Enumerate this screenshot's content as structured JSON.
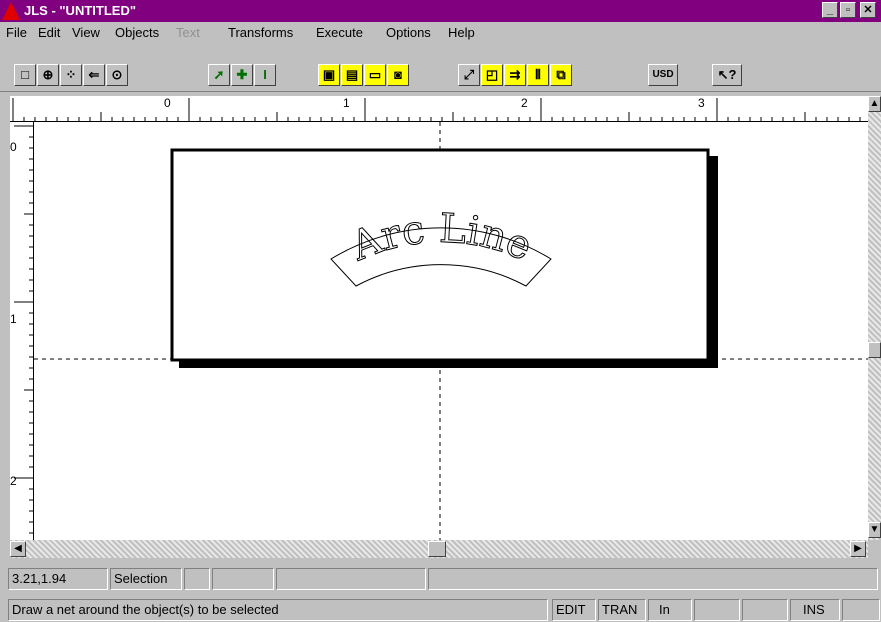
{
  "window": {
    "title": "JLS - \"UNTITLED\"",
    "controls": [
      "_",
      "▫",
      "✕"
    ]
  },
  "menubar": [
    {
      "label": "File"
    },
    {
      "label": "Edit"
    },
    {
      "label": "View"
    },
    {
      "label": "Objects"
    },
    {
      "label": "Text",
      "disabled": true
    },
    {
      "label": "Transforms"
    },
    {
      "label": "Execute"
    },
    {
      "label": "Options"
    },
    {
      "label": "Help"
    }
  ],
  "toolbar": {
    "groups": [
      [
        "new-icon",
        "zoom-icon",
        "grid-icon",
        "back-icon",
        "view-icon"
      ],
      [
        "pointer-icon",
        "add-icon",
        "text-cursor-icon"
      ],
      [
        "object-a-icon",
        "object-b-icon",
        "object-c-icon",
        "object-d-icon"
      ],
      [
        "resize-icon",
        "frame-icon",
        "align-icon",
        "spacing-icon",
        "transform-icon"
      ]
    ],
    "usd_label": "USD",
    "help_icon": "help-pointer-icon"
  },
  "rulers": {
    "horizontal_labels": [
      "0",
      "1",
      "2",
      "3"
    ],
    "vertical_labels": [
      "0",
      "1",
      "2"
    ]
  },
  "canvas": {
    "arc_text": "Arc Line"
  },
  "status": {
    "coords": "3.21,1.94",
    "mode": "Selection",
    "hint": "Draw a net around the object(s) to be selected",
    "indicators": [
      "EDIT",
      "TRAN",
      "In",
      "",
      "",
      "INS",
      ""
    ]
  }
}
